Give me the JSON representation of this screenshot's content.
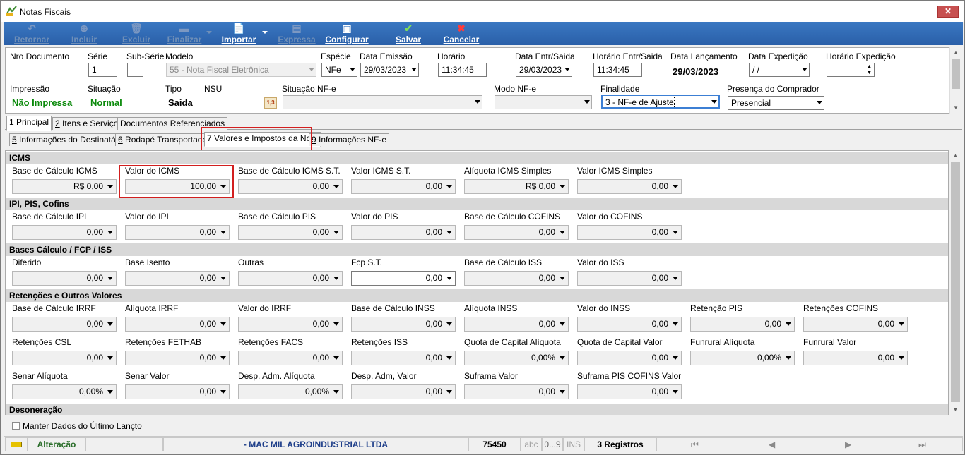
{
  "window": {
    "title": "Notas Fiscais",
    "close": "✕"
  },
  "toolbar": {
    "retornar": "Retornar",
    "incluir": "Incluir",
    "excluir": "Excluir",
    "finalizar": "Finalizar",
    "importar": "Importar",
    "expressa": "Expressa",
    "configurar": "Configurar",
    "salvar": "Salvar",
    "cancelar": "Cancelar"
  },
  "header": {
    "nro_documento_label": "Nro Documento",
    "serie_label": "Série",
    "serie_value": "1",
    "subserie_label": "Sub-Série",
    "subserie_value": "",
    "modelo_label": "Modelo",
    "modelo_value": "55 - Nota Fiscal Eletrônica",
    "especie_label": "Espécie",
    "especie_value": "NFe",
    "data_emissao_label": "Data Emissão",
    "data_emissao_value": "29/03/2023",
    "horario_label": "Horário",
    "horario_value": "11:34:45",
    "data_entr_label": "Data Entr/Saida",
    "data_entr_value": "29/03/2023",
    "horario_entr_label": "Horário Entr/Saida",
    "horario_entr_value": "11:34:45",
    "data_lanc_label": "Data Lançamento",
    "data_lanc_value": "29/03/2023",
    "data_exped_label": "Data Expedição",
    "data_exped_value": " / /",
    "horario_exped_label": "Horário Expedição",
    "horario_exped_value": "",
    "impressao_label": "Impressão",
    "impressao_value": "Não Impressa",
    "situacao_label": "Situação",
    "situacao_value": "Normal",
    "tipo_label": "Tipo",
    "tipo_value": "Saida",
    "nsu_label": "NSU",
    "situacao_nfe_label": "Situação NF-e",
    "situacao_nfe_value": "",
    "modo_nfe_label": "Modo NF-e",
    "modo_nfe_value": "",
    "finalidade_label": "Finalidade",
    "finalidade_value": "3 - NF-e de Ajuste",
    "presenca_label": "Presença do Comprador",
    "presenca_value": "Presencial"
  },
  "tabs1": [
    {
      "num": "1",
      "text": " Principal"
    },
    {
      "num": "2",
      "text": " Itens e Serviços"
    },
    {
      "num": "",
      "text": "Documentos Referenciados"
    }
  ],
  "tabs2": [
    {
      "num": "5",
      "text": " Informações do Destinatário"
    },
    {
      "num": "6",
      "text": " Rodapé Transportador"
    },
    {
      "num": "7",
      "text": " Valores e Impostos da Nota"
    },
    {
      "num": "9",
      "text": " Informações NF-e"
    }
  ],
  "sections": {
    "icms": "ICMS",
    "ipi": "IPI, PIS, Cofins",
    "bases": "Bases Cálculo / FCP / ISS",
    "retencoes": "Retenções e Outros Valores",
    "desoneracao": "Desoneração"
  },
  "icms": [
    {
      "label": "Base de Cálculo ICMS",
      "value": "R$ 0,00"
    },
    {
      "label": "Valor do ICMS",
      "value": "100,00"
    },
    {
      "label": "Base de Cálculo ICMS S.T.",
      "value": "0,00"
    },
    {
      "label": "Valor ICMS S.T.",
      "value": "0,00"
    },
    {
      "label": "Alíquota ICMS Simples",
      "value": "R$ 0,00"
    },
    {
      "label": "Valor ICMS Simples",
      "value": "0,00"
    }
  ],
  "ipi": [
    {
      "label": "Base de Cálculo IPI",
      "value": "0,00"
    },
    {
      "label": "Valor do IPI",
      "value": "0,00"
    },
    {
      "label": "Base de Cálculo PIS",
      "value": "0,00"
    },
    {
      "label": "Valor do PIS",
      "value": "0,00"
    },
    {
      "label": "Base de Cálculo COFINS",
      "value": "0,00"
    },
    {
      "label": "Valor do COFINS",
      "value": "0,00"
    }
  ],
  "bases": [
    {
      "label": "Diferido",
      "value": "0,00"
    },
    {
      "label": "Base Isento",
      "value": "0,00"
    },
    {
      "label": "Outras",
      "value": "0,00"
    },
    {
      "label": "Fcp S.T.",
      "value": "0,00"
    },
    {
      "label": "Base de Cálculo ISS",
      "value": "0,00"
    },
    {
      "label": "Valor do ISS",
      "value": "0,00"
    }
  ],
  "ret1": [
    {
      "label": "Base de Cálculo IRRF",
      "value": "0,00"
    },
    {
      "label": "Alíquota IRRF",
      "value": "0,00"
    },
    {
      "label": "Valor do IRRF",
      "value": "0,00"
    },
    {
      "label": "Base de Cálculo INSS",
      "value": "0,00"
    },
    {
      "label": "Alíquota INSS",
      "value": "0,00"
    },
    {
      "label": "Valor do INSS",
      "value": "0,00"
    },
    {
      "label": "Retenção PIS",
      "value": "0,00"
    },
    {
      "label": "Retenções COFINS",
      "value": "0,00"
    }
  ],
  "ret2": [
    {
      "label": "Retenções CSL",
      "value": "0,00"
    },
    {
      "label": "Retenções FETHAB",
      "value": "0,00"
    },
    {
      "label": "Retenções FACS",
      "value": "0,00"
    },
    {
      "label": "Retenções ISS",
      "value": "0,00"
    },
    {
      "label": "Quota de Capital Alíquota",
      "value": "0,00%"
    },
    {
      "label": "Quota de Capital Valor",
      "value": "0,00"
    },
    {
      "label": "Funrural Alíquota",
      "value": "0,00%"
    },
    {
      "label": "Funrural Valor",
      "value": "0,00"
    }
  ],
  "ret3": [
    {
      "label": "Senar Alíquota",
      "value": "0,00%"
    },
    {
      "label": "Senar Valor",
      "value": "0,00"
    },
    {
      "label": "Desp. Adm. Alíquota",
      "value": "0,00%"
    },
    {
      "label": "Desp. Adm, Valor",
      "value": "0,00"
    },
    {
      "label": "Suframa Valor",
      "value": "0,00"
    },
    {
      "label": "Suframa PIS COFINS Valor",
      "value": "0,00"
    }
  ],
  "footer": {
    "manter": "Manter Dados do Último Lançto"
  },
  "status": {
    "mode": "Alteração",
    "company": "- MAC MIL AGROINDUSTRIAL  LTDA",
    "code": "75450",
    "abc": "abc",
    "range": "0...9",
    "ins": "INS",
    "registros": "3 Registros",
    "first": "⏮",
    "prev": "◀",
    "next": "▶",
    "last": "⏭"
  },
  "colors": {
    "toolbar": "#2f6ab5",
    "highlight": "#d21f1f",
    "green": "#0b8a0b"
  }
}
